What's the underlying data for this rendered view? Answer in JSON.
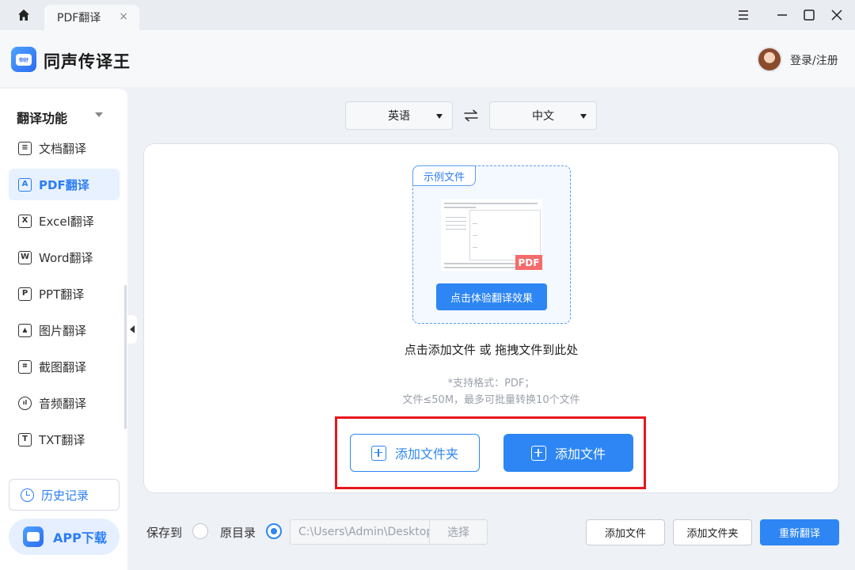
{
  "tabbar": {
    "tab_title": "PDF翻译",
    "tab_close": "×"
  },
  "header": {
    "app_title": "同声传译王",
    "logo_text": "你好",
    "login_label": "登录/注册"
  },
  "sidebar": {
    "section_title": "翻译功能",
    "items": [
      {
        "label": "文档翻译",
        "icon": "document-icon",
        "glyph": "≡"
      },
      {
        "label": "PDF翻译",
        "icon": "pdf-icon",
        "glyph": "A",
        "active": true
      },
      {
        "label": "Excel翻译",
        "icon": "excel-icon",
        "glyph": "X"
      },
      {
        "label": "Word翻译",
        "icon": "word-icon",
        "glyph": "W"
      },
      {
        "label": "PPT翻译",
        "icon": "ppt-icon",
        "glyph": "P"
      },
      {
        "label": "图片翻译",
        "icon": "image-icon",
        "glyph": "▲"
      },
      {
        "label": "截图翻译",
        "icon": "screenshot-icon",
        "glyph": "⌗"
      },
      {
        "label": "音频翻译",
        "icon": "audio-icon",
        "glyph": "ıl"
      },
      {
        "label": "TXT翻译",
        "icon": "txt-icon",
        "glyph": "T"
      }
    ],
    "history_label": "历史记录",
    "app_download_label": "APP下载"
  },
  "language": {
    "source": "英语",
    "target": "中文"
  },
  "sample": {
    "tag": "示例文件",
    "pdf_badge": "PDF",
    "try_button": "点击体验翻译效果"
  },
  "upload": {
    "drop_hint": "点击添加文件 或 拖拽文件到此处",
    "formats_line1": "*支持格式：PDF；",
    "formats_line2": "文件≤50M，最多可批量转换10个文件",
    "add_folder": "添加文件夹",
    "add_file": "添加文件"
  },
  "bottom": {
    "save_to": "保存到",
    "original_dir": "原目录",
    "path_value": "C:\\Users\\Admin\\Desktop",
    "choose": "选择",
    "add_file": "添加文件",
    "add_folder": "添加文件夹",
    "retranslate": "重新翻译"
  },
  "colors": {
    "accent": "#2d86f4",
    "highlight": "#e8161b",
    "pdf_badge": "#f56b6b"
  }
}
